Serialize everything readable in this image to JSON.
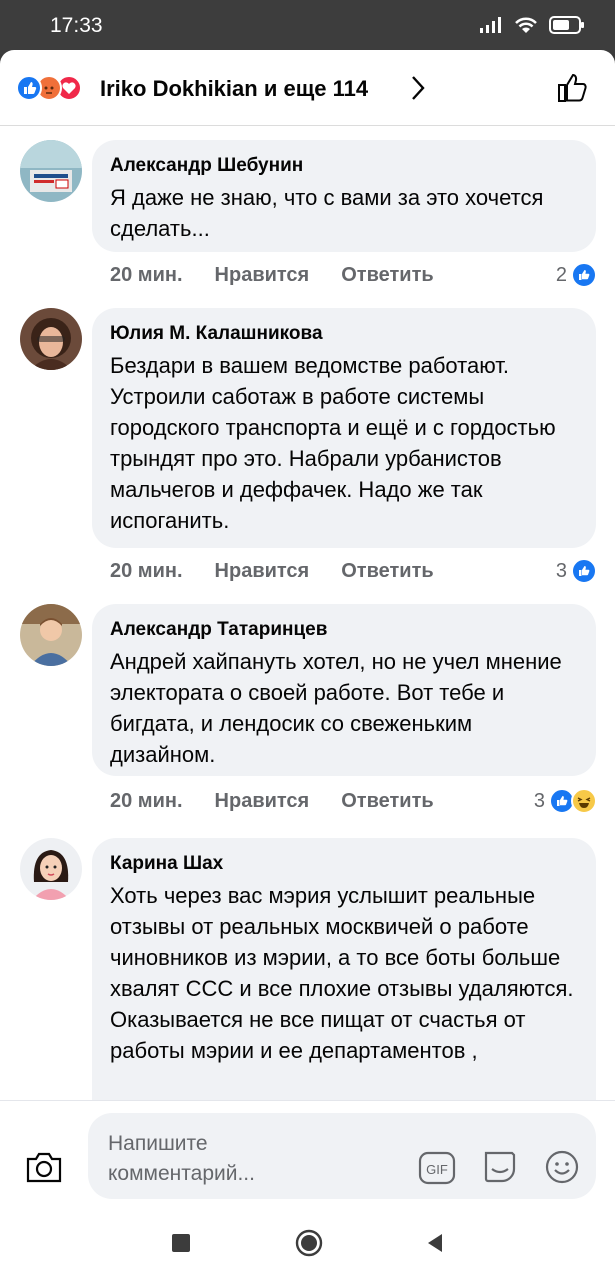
{
  "status_bar": {
    "time": "17:33",
    "battery_icon": "battery-icon",
    "wifi_icon": "wifi-icon",
    "signal_icon": "signal-icon"
  },
  "header": {
    "title": "Iriko Dokhikian и еще 114",
    "reactions": [
      "like",
      "angry",
      "love"
    ]
  },
  "comments": [
    {
      "author": "Александр Шебунин",
      "text": "Я даже не знаю, что с вами за это хочется сделать...",
      "time": "20 мин.",
      "like_label": "Нравится",
      "reply_label": "Ответить",
      "reaction_count": "2"
    },
    {
      "author": "Юлия М. Калашникова",
      "text": "Бездари  в вашем ведомстве работают.  Устроили саботаж в работе системы городского транспорта и ещё и с гордостью трындят про это. Набрали урбанистов мальчегов и деффачек.  Надо же так испоганить.",
      "time": "20 мин.",
      "like_label": "Нравится",
      "reply_label": "Ответить",
      "reaction_count": "3"
    },
    {
      "author": "Александр Татаринцев",
      "text": "Андрей хайпануть хотел, но не учел мнение электората о своей работе. Вот тебе и бигдата, и лендосик со свеженьким дизайном.",
      "time": "20 мин.",
      "like_label": "Нравится",
      "reply_label": "Ответить",
      "reaction_count": "3"
    },
    {
      "author": "Карина Шах",
      "text": "Хоть через вас мэрия услышит реальные отзывы от реальных москвичей о работе чиновников из мэрии, а то все боты больше хвалят ССС и все плохие отзывы удаляются. Оказывается не все пищат от счастья от работы мэрии и ее департаментов ,"
    }
  ],
  "composer": {
    "placeholder": "Напишите комментарий...",
    "gif_label": "GIF"
  },
  "colors": {
    "accent": "#1877f2",
    "bubble": "#f0f2f5",
    "meta": "#65676b"
  }
}
